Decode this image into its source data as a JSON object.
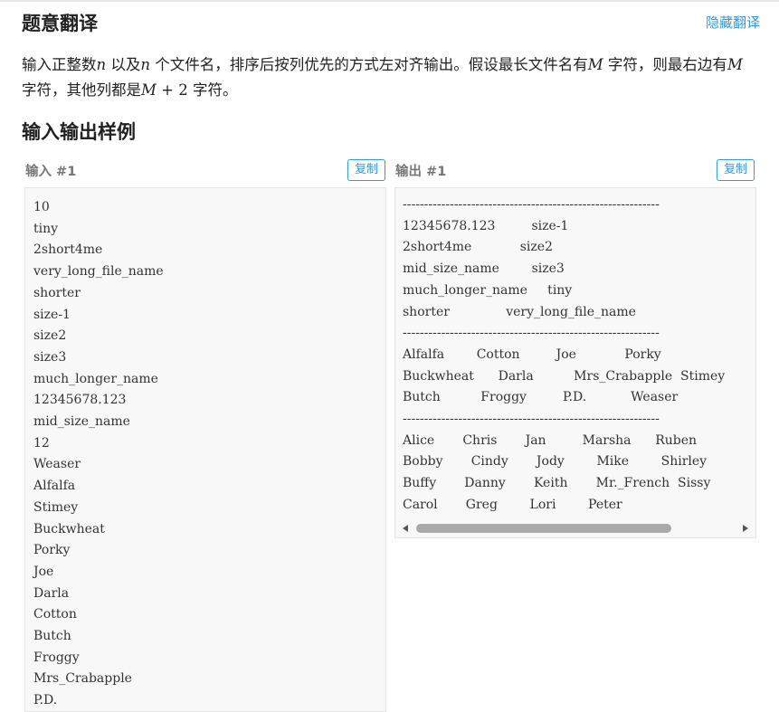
{
  "page": {
    "title": "题意翻译",
    "hide_link": "隐藏翻译",
    "section_title": "输入输出样例"
  },
  "description": {
    "p1": "输入正整数",
    "n": "n",
    "p2": " 以及",
    "n2": "n",
    "p3": " 个文件名，排序后按列优先的方式左对齐输出。假设最长文件名有",
    "M": "M",
    "p4": " 字符，则最右边有",
    "M2": "M",
    "p5": " 字符，其他列都是",
    "M3": "M",
    "plus": " + 2",
    "p6": " 字符。"
  },
  "input_sample": {
    "label": "输入 #1",
    "copy_label": "复制",
    "text": "10\ntiny\n2short4me\nvery_long_file_name\nshorter\nsize-1\nsize2\nsize3\nmuch_longer_name\n12345678.123\nmid_size_name\n12\nWeaser\nAlfalfa\nStimey\nBuckwheat\nPorky\nJoe\nDarla\nCotton\nButch\nFroggy\nMrs_Crabapple\nP.D."
  },
  "output_sample": {
    "label": "输出 #1",
    "copy_label": "复制",
    "text": "------------------------------------------------------------\n12345678.123         size-1\n2short4me            size2\nmid_size_name        size3\nmuch_longer_name     tiny\nshorter              very_long_file_name\n------------------------------------------------------------\nAlfalfa        Cotton         Joe            Porky\nBuckwheat      Darla          Mrs_Crabapple  Stimey\nButch          Froggy         P.D.           Weaser\n------------------------------------------------------------\nAlice       Chris       Jan         Marsha      Ruben\nBobby       Cindy       Jody        Mike        Shirley\nBuffy       Danny       Keith       Mr._French  Sissy\nCarol       Greg        Lori        Peter"
  },
  "colors": {
    "accent": "#3498db",
    "code_bg": "#f8f8f8",
    "border": "#e4e4e4"
  }
}
